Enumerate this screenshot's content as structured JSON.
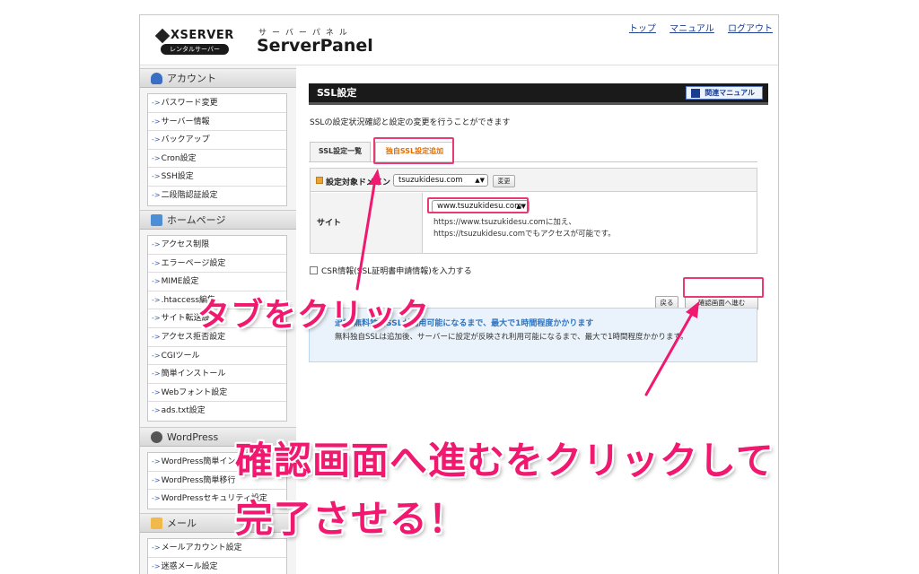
{
  "header": {
    "brand": "XSERVER",
    "brand_sub": "レンタルサーバー",
    "panel_kana": "サーバーパネル",
    "panel_name": "ServerPanel",
    "links": [
      "トップ",
      "マニュアル",
      "ログアウト"
    ]
  },
  "sidebar": {
    "sections": [
      {
        "title": "アカウント",
        "icon": "person-icon",
        "items": [
          "パスワード変更",
          "サーバー情報",
          "バックアップ",
          "Cron設定",
          "SSH設定",
          "二段階認証設定"
        ]
      },
      {
        "title": "ホームページ",
        "icon": "folder-icon",
        "items": [
          "アクセス制限",
          "エラーページ設定",
          "MIME設定",
          ".htaccess編集",
          "サイト転送設定",
          "アクセス拒否設定",
          "CGIツール",
          "簡単インストール",
          "Webフォント設定",
          "ads.txt設定"
        ]
      },
      {
        "title": "WordPress",
        "icon": "wordpress-icon",
        "items": [
          "WordPress簡単インストール",
          "WordPress簡単移行",
          "WordPressセキュリティ設定"
        ]
      },
      {
        "title": "メール",
        "icon": "mail-icon",
        "items": [
          "メールアカウント設定",
          "迷惑メール設定"
        ]
      }
    ]
  },
  "main": {
    "title": "SSL設定",
    "manual_button": "関連マニュアル",
    "description": "SSLの設定状況確認と設定の変更を行うことができます",
    "tabs": [
      "SSL設定一覧",
      "独自SSL設定追加"
    ],
    "active_tab": "独自SSL設定追加",
    "domain_label": "設定対象ドメイン",
    "domain_value": "tsuzukidesu.com",
    "change_button": "変更",
    "site_label": "サイト",
    "site_value": "www.tsuzukidesu.com",
    "site_note_1": "https://www.tsuzukidesu.comに加え、",
    "site_note_2": "https://tsuzukidesu.comでもアクセスが可能です。",
    "csr_label": "CSR情報(SSL証明書申請情報)を入力する",
    "back_button": "戻る",
    "confirm_button": "確認画面へ進む",
    "notice_title": "追加 無料独自SSLが利用可能になるまで、最大で1時間程度かかります",
    "notice_body": "無料独自SSLは追加後、サーバーに設定が反映され利用可能になるまで、最大で1時間程度かかります。"
  },
  "annotations": {
    "tab_caption": "タブをクリック",
    "confirm_caption_1": "確認画面へ進むをクリックして",
    "confirm_caption_2": "完了させる！",
    "highlight_color": "#e83a75",
    "caption_color": "#f0186f"
  }
}
